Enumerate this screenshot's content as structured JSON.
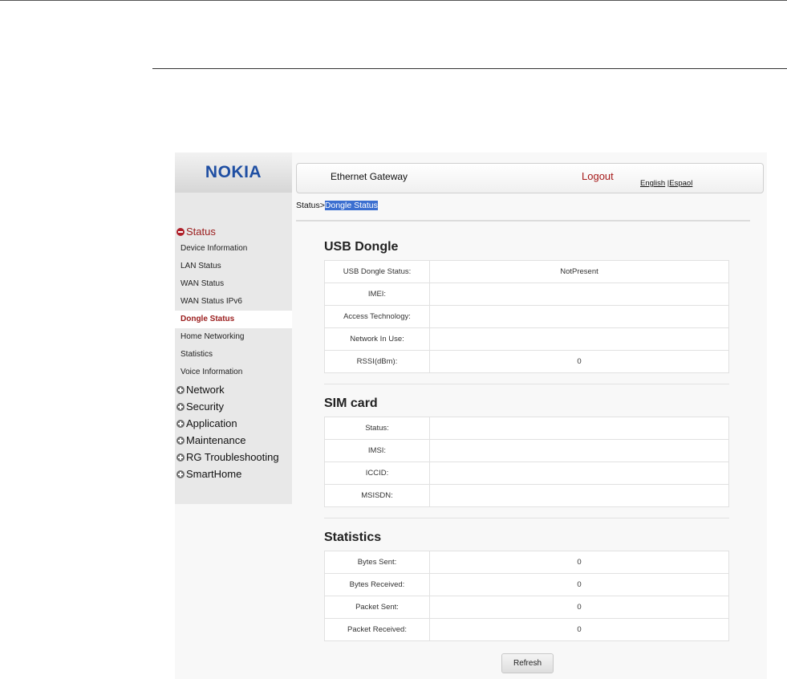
{
  "brand": {
    "logo": "NOKIA"
  },
  "header": {
    "title": "Ethernet Gateway",
    "logout": "Logout",
    "lang_en": "English",
    "lang_sep": " |",
    "lang_es": "Espaol"
  },
  "breadcrumb": {
    "parent": "Status>",
    "current": "Dongle Status"
  },
  "sidebar": {
    "status_group": "Status",
    "status_items": [
      "Device Information",
      "LAN Status",
      "WAN Status",
      "WAN Status IPv6",
      "Dongle Status",
      "Home Networking",
      "Statistics",
      "Voice Information"
    ],
    "active_index": 4,
    "groups": [
      "Network",
      "Security",
      "Application",
      "Maintenance",
      "RG Troubleshooting",
      "SmartHome"
    ]
  },
  "usb_dongle": {
    "title": "USB Dongle",
    "rows": [
      {
        "label": "USB Dongle Status:",
        "value": "NotPresent"
      },
      {
        "label": "IMEI:",
        "value": ""
      },
      {
        "label": "Access Technology:",
        "value": ""
      },
      {
        "label": "Network In Use:",
        "value": ""
      },
      {
        "label": "RSSI(dBm):",
        "value": "0"
      }
    ]
  },
  "sim_card": {
    "title": "SIM card",
    "rows": [
      {
        "label": "Status:",
        "value": ""
      },
      {
        "label": "IMSI:",
        "value": ""
      },
      {
        "label": "ICCID:",
        "value": ""
      },
      {
        "label": "MSISDN:",
        "value": ""
      }
    ]
  },
  "statistics": {
    "title": "Statistics",
    "rows": [
      {
        "label": "Bytes Sent:",
        "value": "0"
      },
      {
        "label": "Bytes Received:",
        "value": "0"
      },
      {
        "label": "Packet Sent:",
        "value": "0"
      },
      {
        "label": "Packet Received:",
        "value": "0"
      }
    ]
  },
  "actions": {
    "refresh": "Refresh"
  },
  "colors": {
    "brand_blue": "#1f4fa3",
    "accent_red": "#9a1b1b",
    "selection_blue": "#3b6fd0"
  }
}
